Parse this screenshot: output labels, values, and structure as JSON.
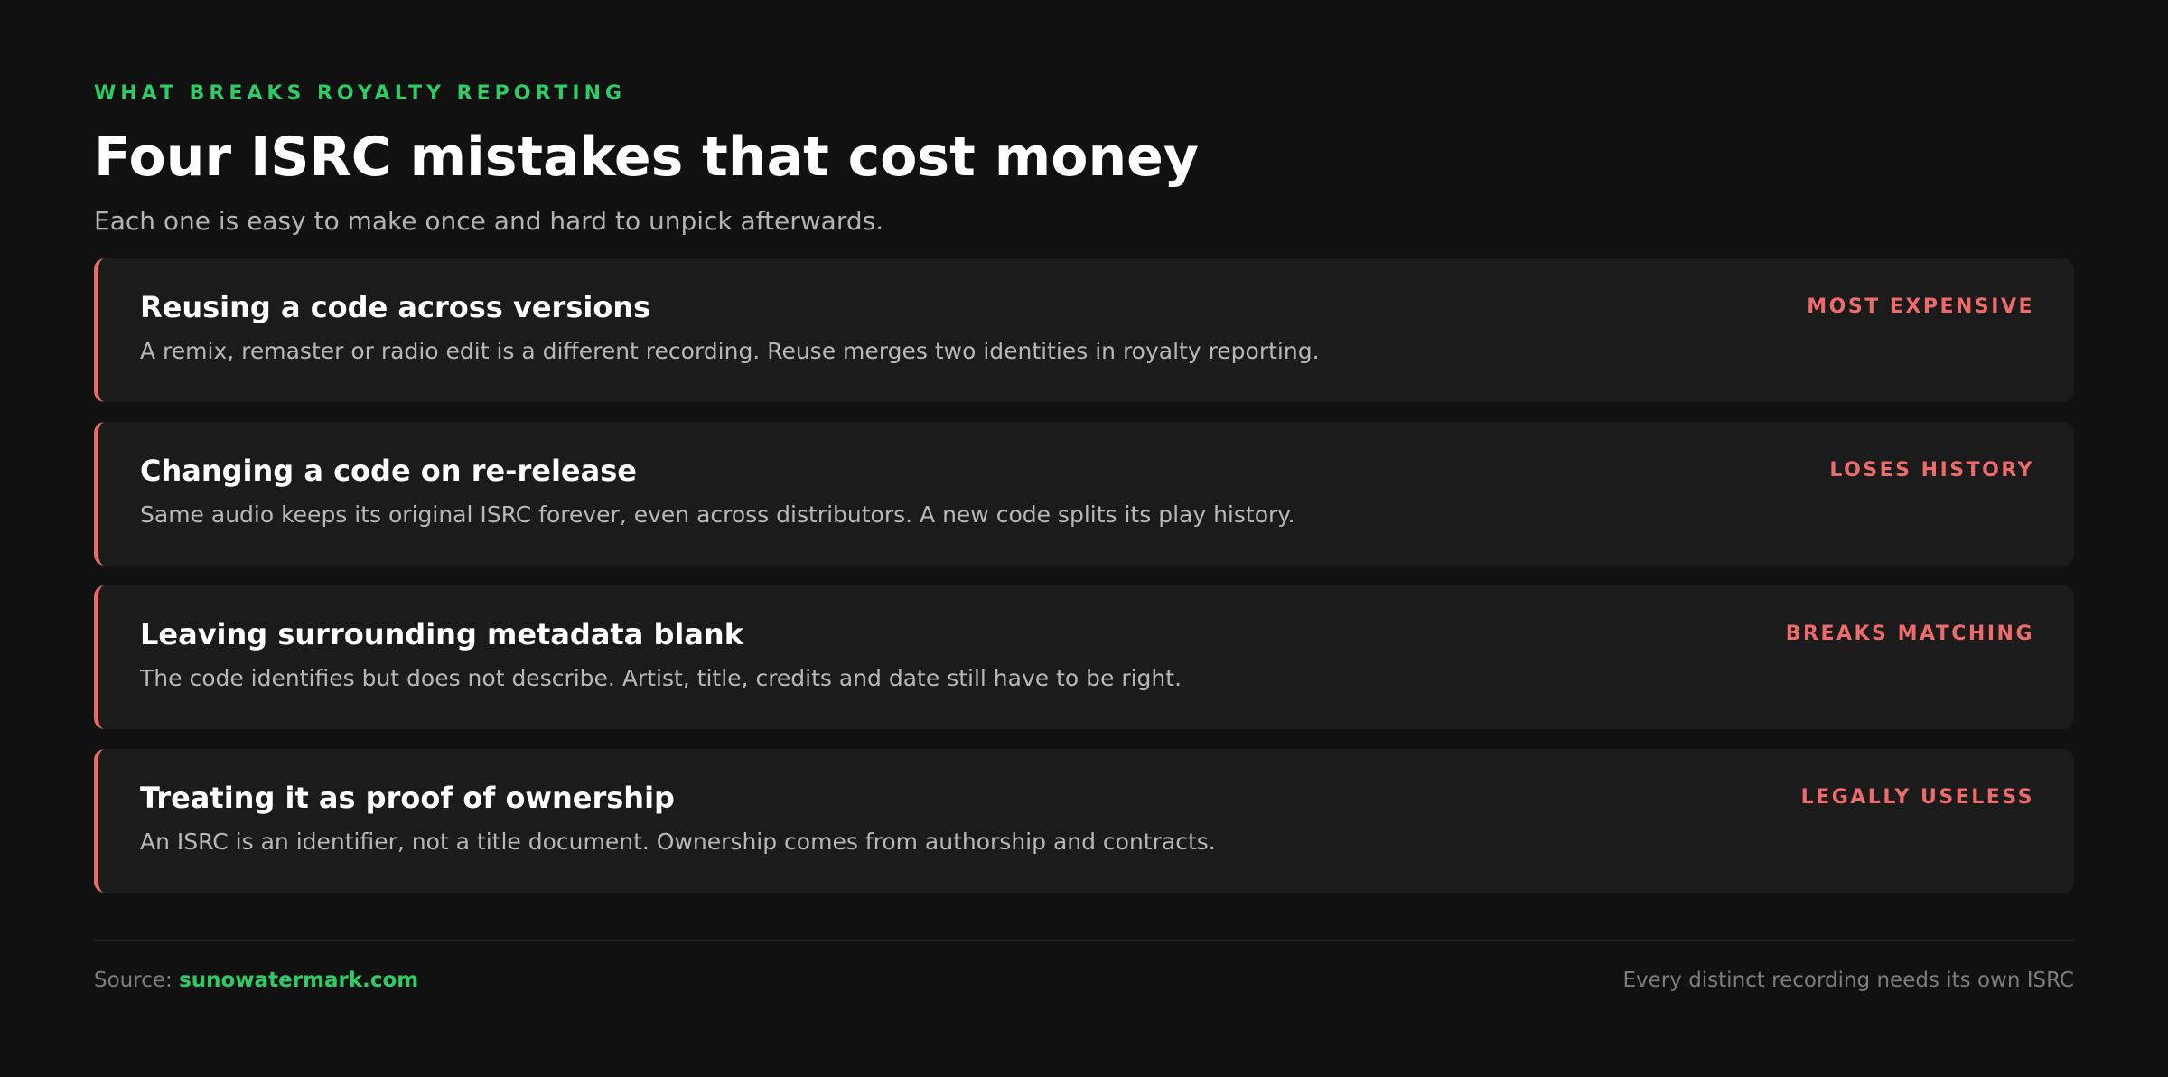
{
  "header": {
    "eyebrow": "WHAT BREAKS ROYALTY REPORTING",
    "title": "Four ISRC mistakes that cost money",
    "subtitle": "Each one is easy to make once and hard to unpick afterwards."
  },
  "mistakes": [
    {
      "title": "Reusing a code across versions",
      "description": "A remix, remaster or radio edit is a different recording. Reuse merges two identities in royalty reporting.",
      "tag": "MOST EXPENSIVE"
    },
    {
      "title": "Changing a code on re-release",
      "description": "Same audio keeps its original ISRC forever, even across distributors. A new code splits its play history.",
      "tag": "LOSES HISTORY"
    },
    {
      "title": "Leaving surrounding metadata blank",
      "description": "The code identifies but does not describe. Artist, title, credits and date still have to be right.",
      "tag": "BREAKS MATCHING"
    },
    {
      "title": "Treating it as proof of ownership",
      "description": "An ISRC is an identifier, not a title document. Ownership comes from authorship and contracts.",
      "tag": "LEGALLY USELESS"
    }
  ],
  "footer": {
    "source_label": "Source:",
    "source_link": "sunowatermark.com",
    "note": "Every distinct recording needs its own ISRC"
  },
  "colors": {
    "background": "#111111",
    "accent_green": "#2ecc65",
    "accent_red": "#ee6b6b",
    "card": "#1b1b1b"
  }
}
